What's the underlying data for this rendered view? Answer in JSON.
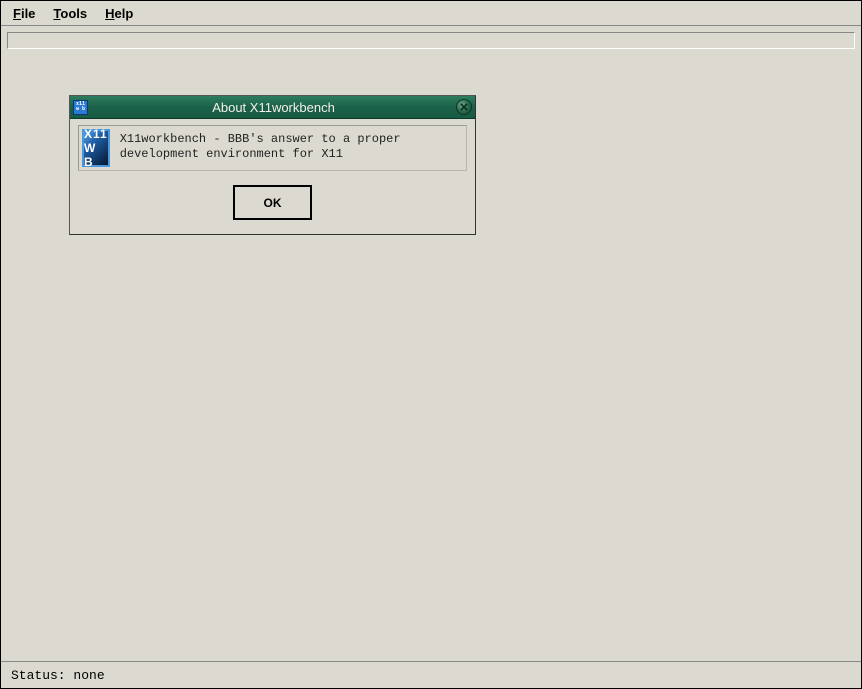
{
  "menubar": {
    "items": [
      {
        "prefix": "F",
        "rest": "ile"
      },
      {
        "prefix": "T",
        "rest": "ools"
      },
      {
        "prefix": "H",
        "rest": "elp"
      }
    ]
  },
  "statusbar": {
    "text": "Status: none"
  },
  "dialog": {
    "title": "About X11workbench",
    "icon_top": "X11",
    "icon_bottom": "W B",
    "titlebar_icon_top": "x11",
    "titlebar_icon_bottom": "w b",
    "message": "X11workbench - BBB's answer to a proper development environment for X11",
    "ok_label": "OK"
  }
}
